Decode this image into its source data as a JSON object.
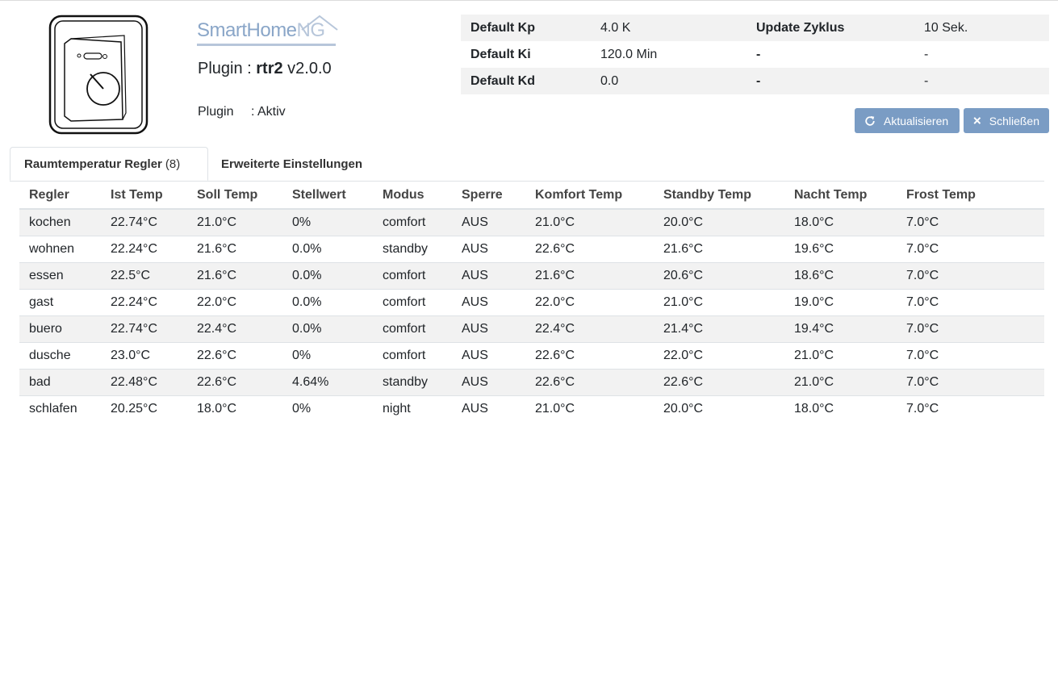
{
  "header": {
    "brand": {
      "main": "SmartHome",
      "suffix": "NG"
    },
    "plugin_prefix": "Plugin : ",
    "plugin_name": "rtr2",
    "plugin_version": " v2.0.0",
    "status_label": "Plugin",
    "status_value": ": Aktiv"
  },
  "params": [
    {
      "k1": "Default Kp",
      "v1": "4.0 K",
      "k2": "Update Zyklus",
      "v2": "10 Sek."
    },
    {
      "k1": "Default Ki",
      "v1": "120.0 Min",
      "k2": "-",
      "v2": "-"
    },
    {
      "k1": "Default Kd",
      "v1": "0.0",
      "k2": "-",
      "v2": "-"
    }
  ],
  "buttons": {
    "refresh": "Aktualisieren",
    "close": "Schließen"
  },
  "tabs": [
    {
      "label": "Raumtemperatur Regler",
      "count": "(8)"
    },
    {
      "label": "Erweiterte Einstellungen"
    }
  ],
  "table": {
    "columns": [
      "Regler",
      "Ist Temp",
      "Soll Temp",
      "Stellwert",
      "Modus",
      "Sperre",
      "Komfort Temp",
      "Standby Temp",
      "Nacht Temp",
      "Frost Temp"
    ],
    "rows": [
      [
        "kochen",
        "22.74°C",
        "21.0°C",
        "0%",
        "comfort",
        "AUS",
        "21.0°C",
        "20.0°C",
        "18.0°C",
        "7.0°C"
      ],
      [
        "wohnen",
        "22.24°C",
        "21.6°C",
        "0.0%",
        "standby",
        "AUS",
        "22.6°C",
        "21.6°C",
        "19.6°C",
        "7.0°C"
      ],
      [
        "essen",
        "22.5°C",
        "21.6°C",
        "0.0%",
        "comfort",
        "AUS",
        "21.6°C",
        "20.6°C",
        "18.6°C",
        "7.0°C"
      ],
      [
        "gast",
        "22.24°C",
        "22.0°C",
        "0.0%",
        "comfort",
        "AUS",
        "22.0°C",
        "21.0°C",
        "19.0°C",
        "7.0°C"
      ],
      [
        "buero",
        "22.74°C",
        "22.4°C",
        "0.0%",
        "comfort",
        "AUS",
        "22.4°C",
        "21.4°C",
        "19.4°C",
        "7.0°C"
      ],
      [
        "dusche",
        "23.0°C",
        "22.6°C",
        "0%",
        "comfort",
        "AUS",
        "22.6°C",
        "22.0°C",
        "21.0°C",
        "7.0°C"
      ],
      [
        "bad",
        "22.48°C",
        "22.6°C",
        "4.64%",
        "standby",
        "AUS",
        "22.6°C",
        "22.6°C",
        "21.0°C",
        "7.0°C"
      ],
      [
        "schlafen",
        "20.25°C",
        "18.0°C",
        "0%",
        "night",
        "AUS",
        "21.0°C",
        "20.0°C",
        "18.0°C",
        "7.0°C"
      ]
    ]
  },
  "icons": {
    "logo": "thermostat-icon",
    "refresh": "refresh-icon",
    "close": "close-icon"
  }
}
